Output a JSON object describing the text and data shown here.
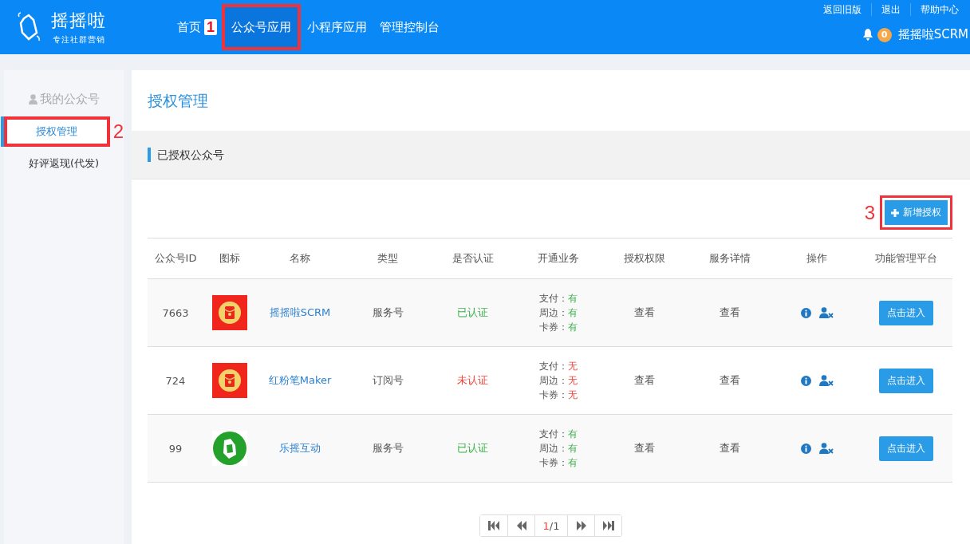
{
  "header": {
    "logo_title": "摇摇啦",
    "logo_subtitle": "专注社群营销",
    "nav": [
      {
        "label": "首页",
        "selected": false,
        "annotation": "1"
      },
      {
        "label": "公众号应用",
        "selected": true,
        "marked": true
      },
      {
        "label": "小程序应用",
        "selected": false
      },
      {
        "label": "管理控制台",
        "selected": false
      }
    ],
    "top_links": [
      "返回旧版",
      "退出",
      "帮助中心"
    ],
    "notification_count": "0",
    "account": "摇摇啦SCRM"
  },
  "sidebar": {
    "heading": "我的公众号",
    "items": [
      {
        "label": "授权管理",
        "selected": true,
        "marked": true,
        "annotation": "2"
      },
      {
        "label": "好评返现(代发)",
        "selected": false
      }
    ]
  },
  "page_title": "授权管理",
  "section_title": "已授权公众号",
  "add_button": {
    "label": "新增授权",
    "marked": true,
    "annotation": "3"
  },
  "table": {
    "columns": [
      "公众号ID",
      "图标",
      "名称",
      "类型",
      "是否认证",
      "开通业务",
      "授权权限",
      "服务详情",
      "操作",
      "功能管理平台"
    ],
    "rows": [
      {
        "id": "7663",
        "kind": "envelope",
        "name": "摇摇啦SCRM",
        "type": "服务号",
        "verification": "已认证",
        "verified": true,
        "services": [
          {
            "label": "支付：",
            "value": "有",
            "available": true
          },
          {
            "label": "周边：",
            "value": "有",
            "available": true
          },
          {
            "label": "卡券：",
            "value": "有",
            "available": true
          }
        ],
        "permissions": "查看",
        "details": "查看",
        "enter": "点击进入"
      },
      {
        "id": "724",
        "kind": "envelope",
        "name": "红粉笔Maker",
        "type": "订阅号",
        "verification": "未认证",
        "verified": false,
        "services": [
          {
            "label": "支付：",
            "value": "无",
            "available": false
          },
          {
            "label": "周边：",
            "value": "无",
            "available": false
          },
          {
            "label": "卡券：",
            "value": "无",
            "available": false
          }
        ],
        "permissions": "查看",
        "details": "查看",
        "enter": "点击进入"
      },
      {
        "id": "99",
        "kind": "mascot",
        "name": "乐摇互动",
        "type": "服务号",
        "verification": "已认证",
        "verified": true,
        "services": [
          {
            "label": "支付：",
            "value": "有",
            "available": true
          },
          {
            "label": "周边：",
            "value": "有",
            "available": true
          },
          {
            "label": "卡券：",
            "value": "有",
            "available": true
          }
        ],
        "permissions": "查看",
        "details": "查看",
        "enter": "点击进入"
      }
    ]
  },
  "pagination": {
    "current": "1",
    "total": "/1"
  }
}
